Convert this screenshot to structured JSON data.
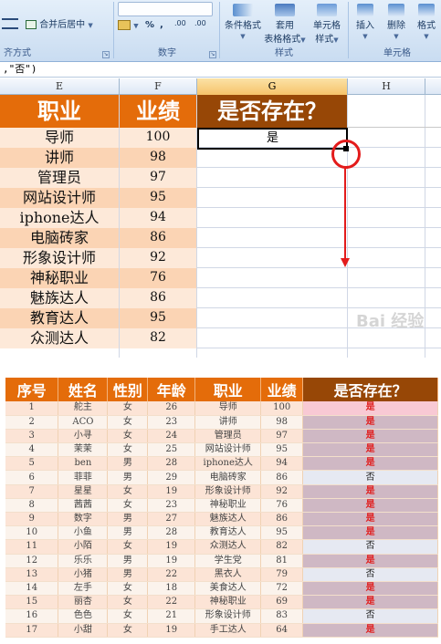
{
  "ribbon": {
    "alignment_group": {
      "label": "齐方式",
      "merge_button": "合并后居中"
    },
    "number_group": {
      "label": "数字",
      "percent": "%",
      "comma": ",",
      "inc_decimal": ".00",
      "dec_decimal": ".00"
    },
    "style_group": {
      "label": "样式",
      "conditional_format": "条件格式",
      "table_format_top": "套用",
      "table_format_bottom": "表格格式",
      "cell_style_top": "单元格",
      "cell_style_bottom": "样式"
    },
    "cells_group": {
      "label": "单元格",
      "insert": "插入",
      "delete": "删除",
      "format": "格式"
    }
  },
  "formula_bar": {
    "text": ",\"否\")"
  },
  "sheet": {
    "columns": [
      "E",
      "F",
      "G",
      "H"
    ],
    "selected_column": "G",
    "headers": {
      "job": "职业",
      "score": "业绩",
      "exists": "是否存在？"
    },
    "active_cell_value": "是",
    "rows": [
      {
        "job": "导师",
        "score": "100"
      },
      {
        "job": "讲师",
        "score": "98"
      },
      {
        "job": "管理员",
        "score": "97"
      },
      {
        "job": "网站设计师",
        "score": "95"
      },
      {
        "job": "iphone达人",
        "score": "94"
      },
      {
        "job": "电脑砖家",
        "score": "86"
      },
      {
        "job": "形象设计师",
        "score": "92"
      },
      {
        "job": "神秘职业",
        "score": "76"
      },
      {
        "job": "魅族达人",
        "score": "86"
      },
      {
        "job": "教育达人",
        "score": "95"
      },
      {
        "job": "众测达人",
        "score": "82"
      }
    ],
    "watermark": "Bai 经验"
  },
  "result_table": {
    "headers": [
      "序号",
      "姓名",
      "性别",
      "年龄",
      "职业",
      "业绩",
      "是否存在？"
    ],
    "rows": [
      [
        "1",
        "舵主",
        "女",
        "26",
        "导师",
        "100",
        "是"
      ],
      [
        "2",
        "ACO",
        "女",
        "23",
        "讲师",
        "98",
        "是"
      ],
      [
        "3",
        "小寻",
        "女",
        "24",
        "管理员",
        "97",
        "是"
      ],
      [
        "4",
        "茉茉",
        "女",
        "25",
        "网站设计师",
        "95",
        "是"
      ],
      [
        "5",
        "ben",
        "男",
        "28",
        "iphone达人",
        "94",
        "是"
      ],
      [
        "6",
        "菲菲",
        "男",
        "29",
        "电脑砖家",
        "86",
        "否"
      ],
      [
        "7",
        "星星",
        "女",
        "19",
        "形象设计师",
        "92",
        "是"
      ],
      [
        "8",
        "茜茜",
        "女",
        "23",
        "神秘职业",
        "76",
        "是"
      ],
      [
        "9",
        "数字",
        "男",
        "27",
        "魅族达人",
        "86",
        "是"
      ],
      [
        "10",
        "小鱼",
        "男",
        "28",
        "教育达人",
        "95",
        "是"
      ],
      [
        "11",
        "小陌",
        "女",
        "19",
        "众测达人",
        "82",
        "否"
      ],
      [
        "12",
        "乐乐",
        "男",
        "19",
        "学生党",
        "81",
        "是"
      ],
      [
        "13",
        "小猪",
        "男",
        "22",
        "黑衣人",
        "79",
        "否"
      ],
      [
        "14",
        "左手",
        "女",
        "18",
        "美食达人",
        "72",
        "是"
      ],
      [
        "15",
        "丽杏",
        "女",
        "22",
        "神秘职业",
        "69",
        "是"
      ],
      [
        "16",
        "色色",
        "女",
        "21",
        "形象设计师",
        "83",
        "否"
      ],
      [
        "17",
        "小甜",
        "女",
        "19",
        "手工达人",
        "64",
        "是"
      ]
    ]
  },
  "colors": {
    "header_orange": "#e46c0a",
    "header_brown": "#974706",
    "row_peach": "#fce4d6",
    "annotation_red": "#e31b1b"
  }
}
